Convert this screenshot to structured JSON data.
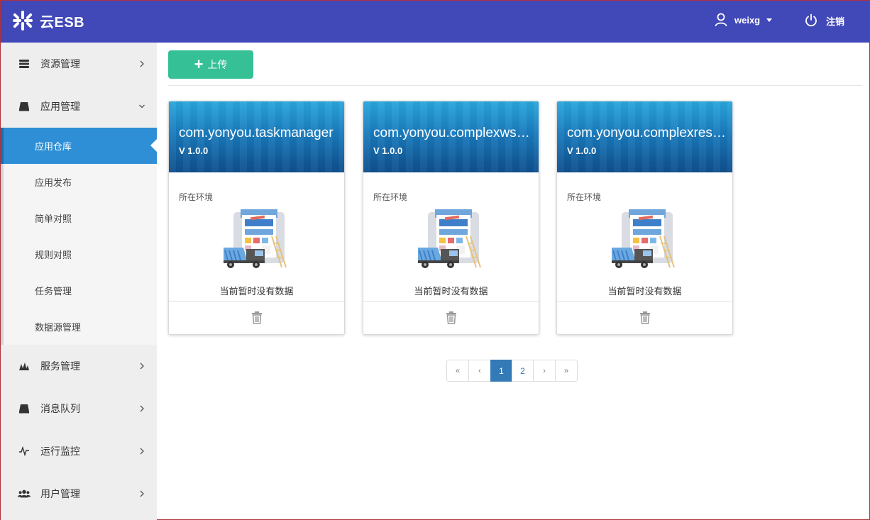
{
  "header": {
    "logo_text": "云ESB",
    "user_name": "weixg",
    "logout_label": "注销",
    "bg_color": "#4148b8"
  },
  "sidebar": {
    "items": [
      {
        "label": "资源管理",
        "icon": "database-icon",
        "expanded": false
      },
      {
        "label": "应用管理",
        "icon": "drive-icon",
        "expanded": true
      },
      {
        "label": "服务管理",
        "icon": "services-icon",
        "expanded": false
      },
      {
        "label": "消息队列",
        "icon": "queue-icon",
        "expanded": false
      },
      {
        "label": "运行监控",
        "icon": "pulse-icon",
        "expanded": false
      },
      {
        "label": "用户管理",
        "icon": "users-icon",
        "expanded": false
      }
    ],
    "submenu": [
      {
        "label": "应用仓库",
        "active": true
      },
      {
        "label": "应用发布",
        "active": false
      },
      {
        "label": "简单对照",
        "active": false
      },
      {
        "label": "规则对照",
        "active": false
      },
      {
        "label": "任务管理",
        "active": false
      },
      {
        "label": "数据源管理",
        "active": false
      }
    ],
    "active_color": "#2e8fd6"
  },
  "toolbar": {
    "upload_label": "上传",
    "upload_color": "#35c095"
  },
  "cards": [
    {
      "title": "com.yonyou.taskmanager",
      "version": "V 1.0.0",
      "env_label": "所在环境",
      "empty_text": "当前暂时没有数据"
    },
    {
      "title": "com.yonyou.complexws0...",
      "version": "V 1.0.0",
      "env_label": "所在环境",
      "empty_text": "当前暂时没有数据"
    },
    {
      "title": "com.yonyou.complexrest...",
      "version": "V 1.0.0",
      "env_label": "所在环境",
      "empty_text": "当前暂时没有数据"
    }
  ],
  "pagination": {
    "first": "«",
    "prev": "‹",
    "pages": [
      "1",
      "2"
    ],
    "current": "1",
    "next": "›",
    "last": "»"
  }
}
